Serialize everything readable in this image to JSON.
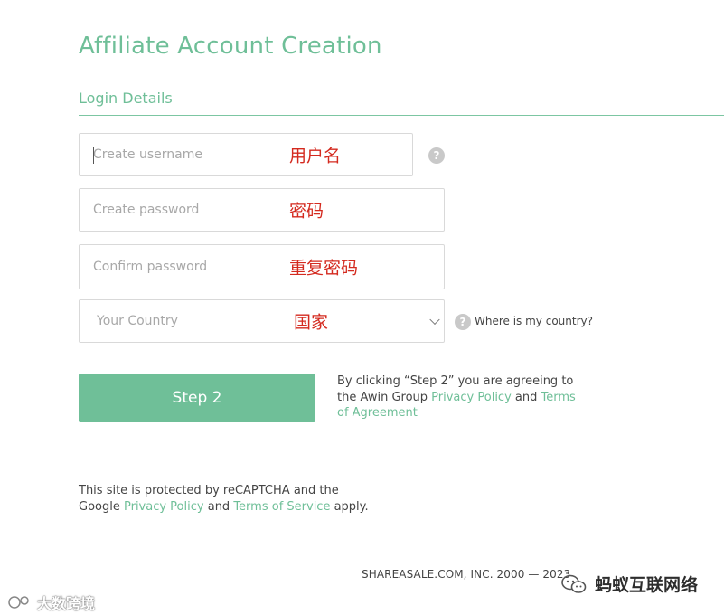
{
  "page": {
    "title": "Affiliate Account Creation",
    "section": "Login Details"
  },
  "form": {
    "username": {
      "placeholder": "Create username",
      "annotation": "用户名",
      "help": "?"
    },
    "password": {
      "placeholder": "Create password",
      "annotation": "密码"
    },
    "confirm": {
      "placeholder": "Confirm password",
      "annotation": "重复密码"
    },
    "country": {
      "placeholder": "Your Country",
      "annotation": "国家",
      "help": "?",
      "help_text": "Where is my country?"
    }
  },
  "step_button": {
    "label": "Step 2"
  },
  "terms": {
    "prefix": "By clicking “Step 2” you are agreeing to the Awin Group ",
    "privacy_link": "Privacy Policy",
    "and": " and ",
    "terms_link": "Terms of Agreement"
  },
  "recaptcha": {
    "prefix": "This site is protected by reCAPTCHA and the Google ",
    "privacy_link": "Privacy Policy",
    "and": " and ",
    "terms_link": "Terms of Service",
    "suffix": " apply."
  },
  "footer": {
    "text": "SHAREASALE.COM, INC. 2000 — 2023"
  },
  "watermarks": {
    "left": "大数跨境",
    "right": "蚂蚁互联网络"
  },
  "colors": {
    "accent": "#6fbf98",
    "annotation": "#d42a1f",
    "help_icon": "#c9c9c9"
  }
}
